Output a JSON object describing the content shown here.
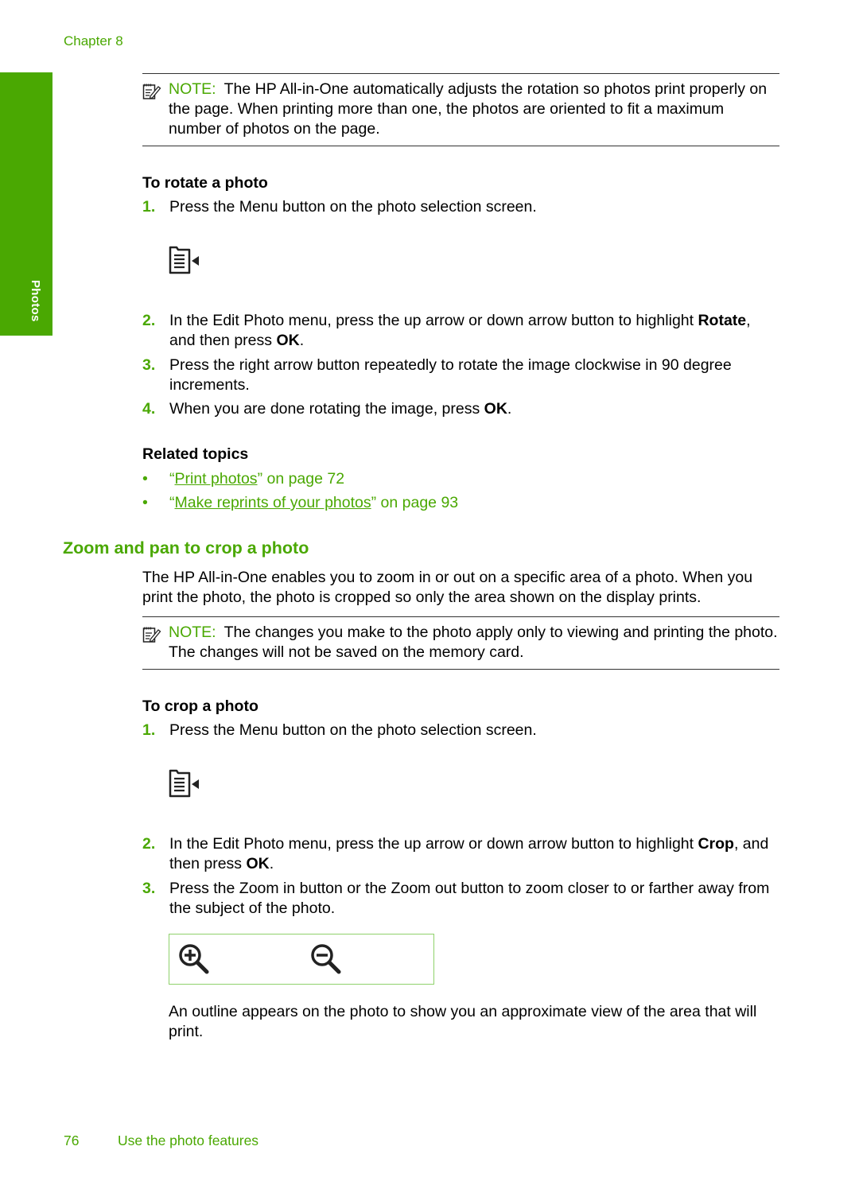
{
  "header": {
    "chapter": "Chapter 8"
  },
  "side_tab": {
    "label": "Photos"
  },
  "colors": {
    "accent": "#4aa802",
    "zoom_box_border": "#8fd16b"
  },
  "note1": {
    "label": "NOTE:",
    "text": "The HP All-in-One automatically adjusts the rotation so photos print properly on the page. When printing more than one, the photos are oriented to fit a maximum number of photos on the page."
  },
  "rotate": {
    "title": "To rotate a photo",
    "steps": [
      {
        "num": "1.",
        "text": "Press the Menu button on the photo selection screen."
      },
      {
        "num": "2.",
        "pre": "In the Edit Photo menu, press the up arrow or down arrow button to highlight ",
        "b1": "Rotate",
        "mid": ", and then press ",
        "b2": "OK",
        "post": "."
      },
      {
        "num": "3.",
        "text": "Press the right arrow button repeatedly to rotate the image clockwise in 90 degree increments."
      },
      {
        "num": "4.",
        "pre": "When you are done rotating the image, press ",
        "b1": "OK",
        "post": "."
      }
    ],
    "icon": "menu-icon"
  },
  "related": {
    "title": "Related topics",
    "bullet": "•",
    "items": [
      {
        "open": "“",
        "link": "Print photos",
        "close": "” on page 72"
      },
      {
        "open": "“",
        "link": "Make reprints of your photos",
        "close": "” on page 93"
      }
    ]
  },
  "section": {
    "title": "Zoom and pan to crop a photo",
    "intro": "The HP All-in-One enables you to zoom in or out on a specific area of a photo. When you print the photo, the photo is cropped so only the area shown on the display prints."
  },
  "note2": {
    "label": "NOTE:",
    "text": "The changes you make to the photo apply only to viewing and printing the photo. The changes will not be saved on the memory card."
  },
  "crop": {
    "title": "To crop a photo",
    "steps": [
      {
        "num": "1.",
        "text": "Press the Menu button on the photo selection screen."
      },
      {
        "num": "2.",
        "pre": "In the Edit Photo menu, press the up arrow or down arrow button to highlight ",
        "b1": "Crop",
        "mid": ", and then press ",
        "b2": "OK",
        "post": "."
      },
      {
        "num": "3.",
        "text": "Press the Zoom in button or the Zoom out button to zoom closer to or farther away from the subject of the photo."
      }
    ],
    "icons": [
      "zoom-in-icon",
      "zoom-out-icon"
    ],
    "outro": "An outline appears on the photo to show you an approximate view of the area that will print."
  },
  "footer": {
    "page_number": "76",
    "title": "Use the photo features"
  }
}
